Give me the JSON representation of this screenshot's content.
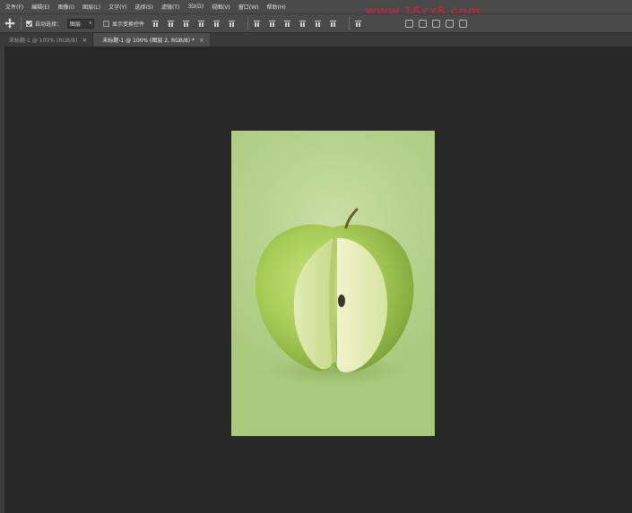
{
  "menu": {
    "items": [
      "文件(F)",
      "编辑(E)",
      "图像(I)",
      "图层(L)",
      "文字(Y)",
      "选择(S)",
      "滤镜(T)",
      "3D(D)",
      "视图(V)",
      "窗口(W)",
      "帮助(H)"
    ]
  },
  "options": {
    "auto_select_label": "自动选择：",
    "auto_select_checked": true,
    "auto_select_target": "图层",
    "show_transform_label": "显示变换控件",
    "show_transform_checked": false
  },
  "watermark": "www.16xx8.com",
  "tabs": [
    {
      "label": "未标题-1 @ 100% (RGB/8)",
      "active": false
    },
    {
      "label": "未标题-1 @ 100% (图层 2, RGB/8) *",
      "active": true
    }
  ],
  "tab_close_glyph": "×",
  "colors": {
    "chrome": "#4a4a4a",
    "workspace": "#282828",
    "tab_active": "#4d4d4d",
    "watermark": "#c0283a",
    "apple_green": "#a9cf63"
  },
  "icons": {
    "move_tool": "move-tool-icon",
    "dropdown": "chevron-down-icon",
    "align": "align-icon",
    "close": "close-icon"
  },
  "document": {
    "content": "green apple with a wedge cut out on a pale green background"
  }
}
